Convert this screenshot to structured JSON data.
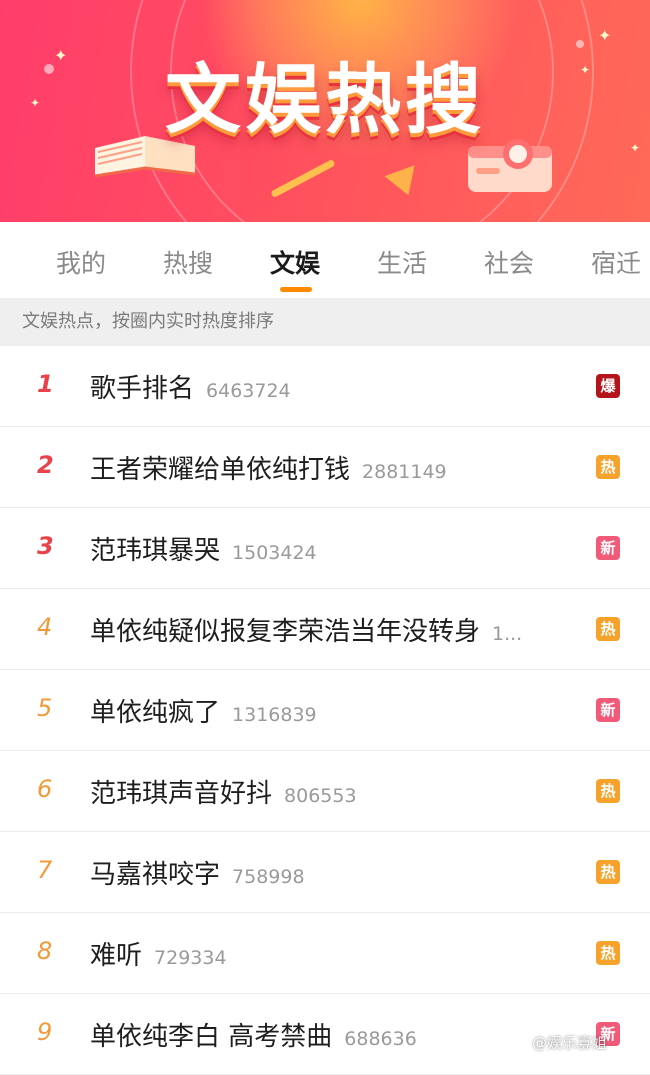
{
  "banner": {
    "title": "文娱热搜"
  },
  "tabs": [
    {
      "label": "我的",
      "active": false
    },
    {
      "label": "热搜",
      "active": false
    },
    {
      "label": "文娱",
      "active": true
    },
    {
      "label": "生活",
      "active": false
    },
    {
      "label": "社会",
      "active": false
    },
    {
      "label": "宿迁",
      "active": false
    }
  ],
  "info_text": "文娱热点，按圈内实时热度排序",
  "items": [
    {
      "rank": "1",
      "title": "歌手排名",
      "count": "6463724",
      "badge": "爆"
    },
    {
      "rank": "2",
      "title": "王者荣耀给单依纯打钱",
      "count": "2881149",
      "badge": "热"
    },
    {
      "rank": "3",
      "title": "范玮琪暴哭",
      "count": "1503424",
      "badge": "新"
    },
    {
      "rank": "4",
      "title": "单依纯疑似报复李荣浩当年没转身",
      "count": "1...",
      "badge": "热"
    },
    {
      "rank": "5",
      "title": "单依纯疯了",
      "count": "1316839",
      "badge": "新"
    },
    {
      "rank": "6",
      "title": "范玮琪声音好抖",
      "count": "806553",
      "badge": "热"
    },
    {
      "rank": "7",
      "title": "马嘉祺咬字",
      "count": "758998",
      "badge": "热"
    },
    {
      "rank": "8",
      "title": "难听",
      "count": "729334",
      "badge": "热"
    },
    {
      "rank": "9",
      "title": "单依纯李白 高考禁曲",
      "count": "688636",
      "badge": "新"
    }
  ],
  "badge_colors": {
    "爆": "#b3151b",
    "热": "#f7a22a",
    "新": "#f25a7a"
  },
  "accent_color": "#ff8a00",
  "watermark": "@娱乐寡姐"
}
